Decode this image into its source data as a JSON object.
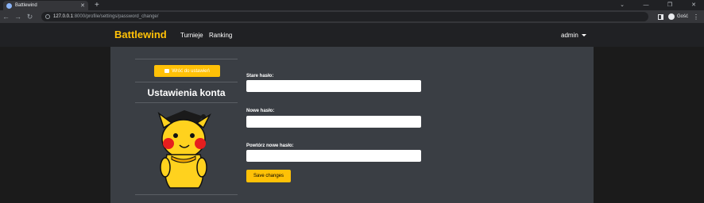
{
  "browser": {
    "tab_title": "Battlewind",
    "url_host": "127.0.0.1",
    "url_path": ":8000/profile/settings/password_change/",
    "profile_label": "Gość"
  },
  "navbar": {
    "brand": "Battlewind",
    "links": [
      "Turnieje",
      "Ranking"
    ],
    "user": "admin"
  },
  "sidebar": {
    "back_label": "Wróć do ustawień",
    "title": "Ustawienia konta"
  },
  "form": {
    "old_password_label": "Stare hasło:",
    "new_password_label": "Nowe hasło:",
    "confirm_password_label": "Powtórz nowe hasło:",
    "save_label": "Save changes"
  },
  "colors": {
    "accent": "#ffc107",
    "navbar_bg": "#202124",
    "panel_bg": "#3a3e44"
  }
}
